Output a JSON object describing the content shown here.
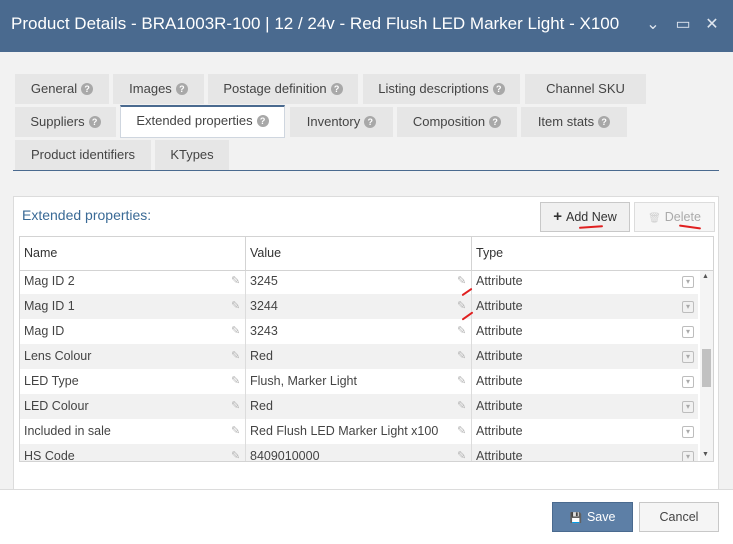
{
  "window": {
    "title": "Product Details - BRA1003R-100 | 12 / 24v - Red Flush LED Marker Light - X100",
    "controls": {
      "collapse": "⌄",
      "maximize": "▭",
      "close": "✕"
    }
  },
  "tabs": [
    {
      "label": "General"
    },
    {
      "label": "Images"
    },
    {
      "label": "Postage definition"
    },
    {
      "label": "Listing descriptions"
    },
    {
      "label": "Channel SKU"
    },
    {
      "label": "Suppliers"
    },
    {
      "label": "Extended properties",
      "active": true
    },
    {
      "label": "Inventory"
    },
    {
      "label": "Composition"
    },
    {
      "label": "Item stats"
    },
    {
      "label": "Product identifiers"
    },
    {
      "label": "KTypes"
    }
  ],
  "help_glyph": "?",
  "panel": {
    "title": "Extended properties:",
    "add_new_icon": "+",
    "add_new_label": "Add New",
    "delete_icon": "🗑",
    "delete_label": "Delete"
  },
  "grid": {
    "columns": [
      "Name",
      "Value",
      "Type"
    ],
    "rows": [
      {
        "name": "Mag ID 2",
        "value": "3245",
        "type": "Attribute"
      },
      {
        "name": "Mag ID 1",
        "value": "3244",
        "type": "Attribute"
      },
      {
        "name": "Mag ID",
        "value": "3243",
        "type": "Attribute"
      },
      {
        "name": "Lens Colour",
        "value": "Red",
        "type": "Attribute"
      },
      {
        "name": "LED Type",
        "value": "Flush, Marker Light",
        "type": "Attribute"
      },
      {
        "name": "LED Colour",
        "value": "Red",
        "type": "Attribute"
      },
      {
        "name": "Included in sale",
        "value": "Red Flush LED Marker Light x100",
        "type": "Attribute"
      },
      {
        "name": "HS Code",
        "value": "8409010000",
        "type": "Attribute"
      }
    ],
    "edit_glyph": "✎",
    "dropdown_glyph": "▾"
  },
  "footer": {
    "save_icon": "💾",
    "save_label": "Save",
    "cancel_label": "Cancel"
  },
  "colors": {
    "title_bar": "#4a6a8f",
    "accent": "#3a6a96",
    "annotation": "#e02020",
    "save_button": "#5d7fa6"
  }
}
